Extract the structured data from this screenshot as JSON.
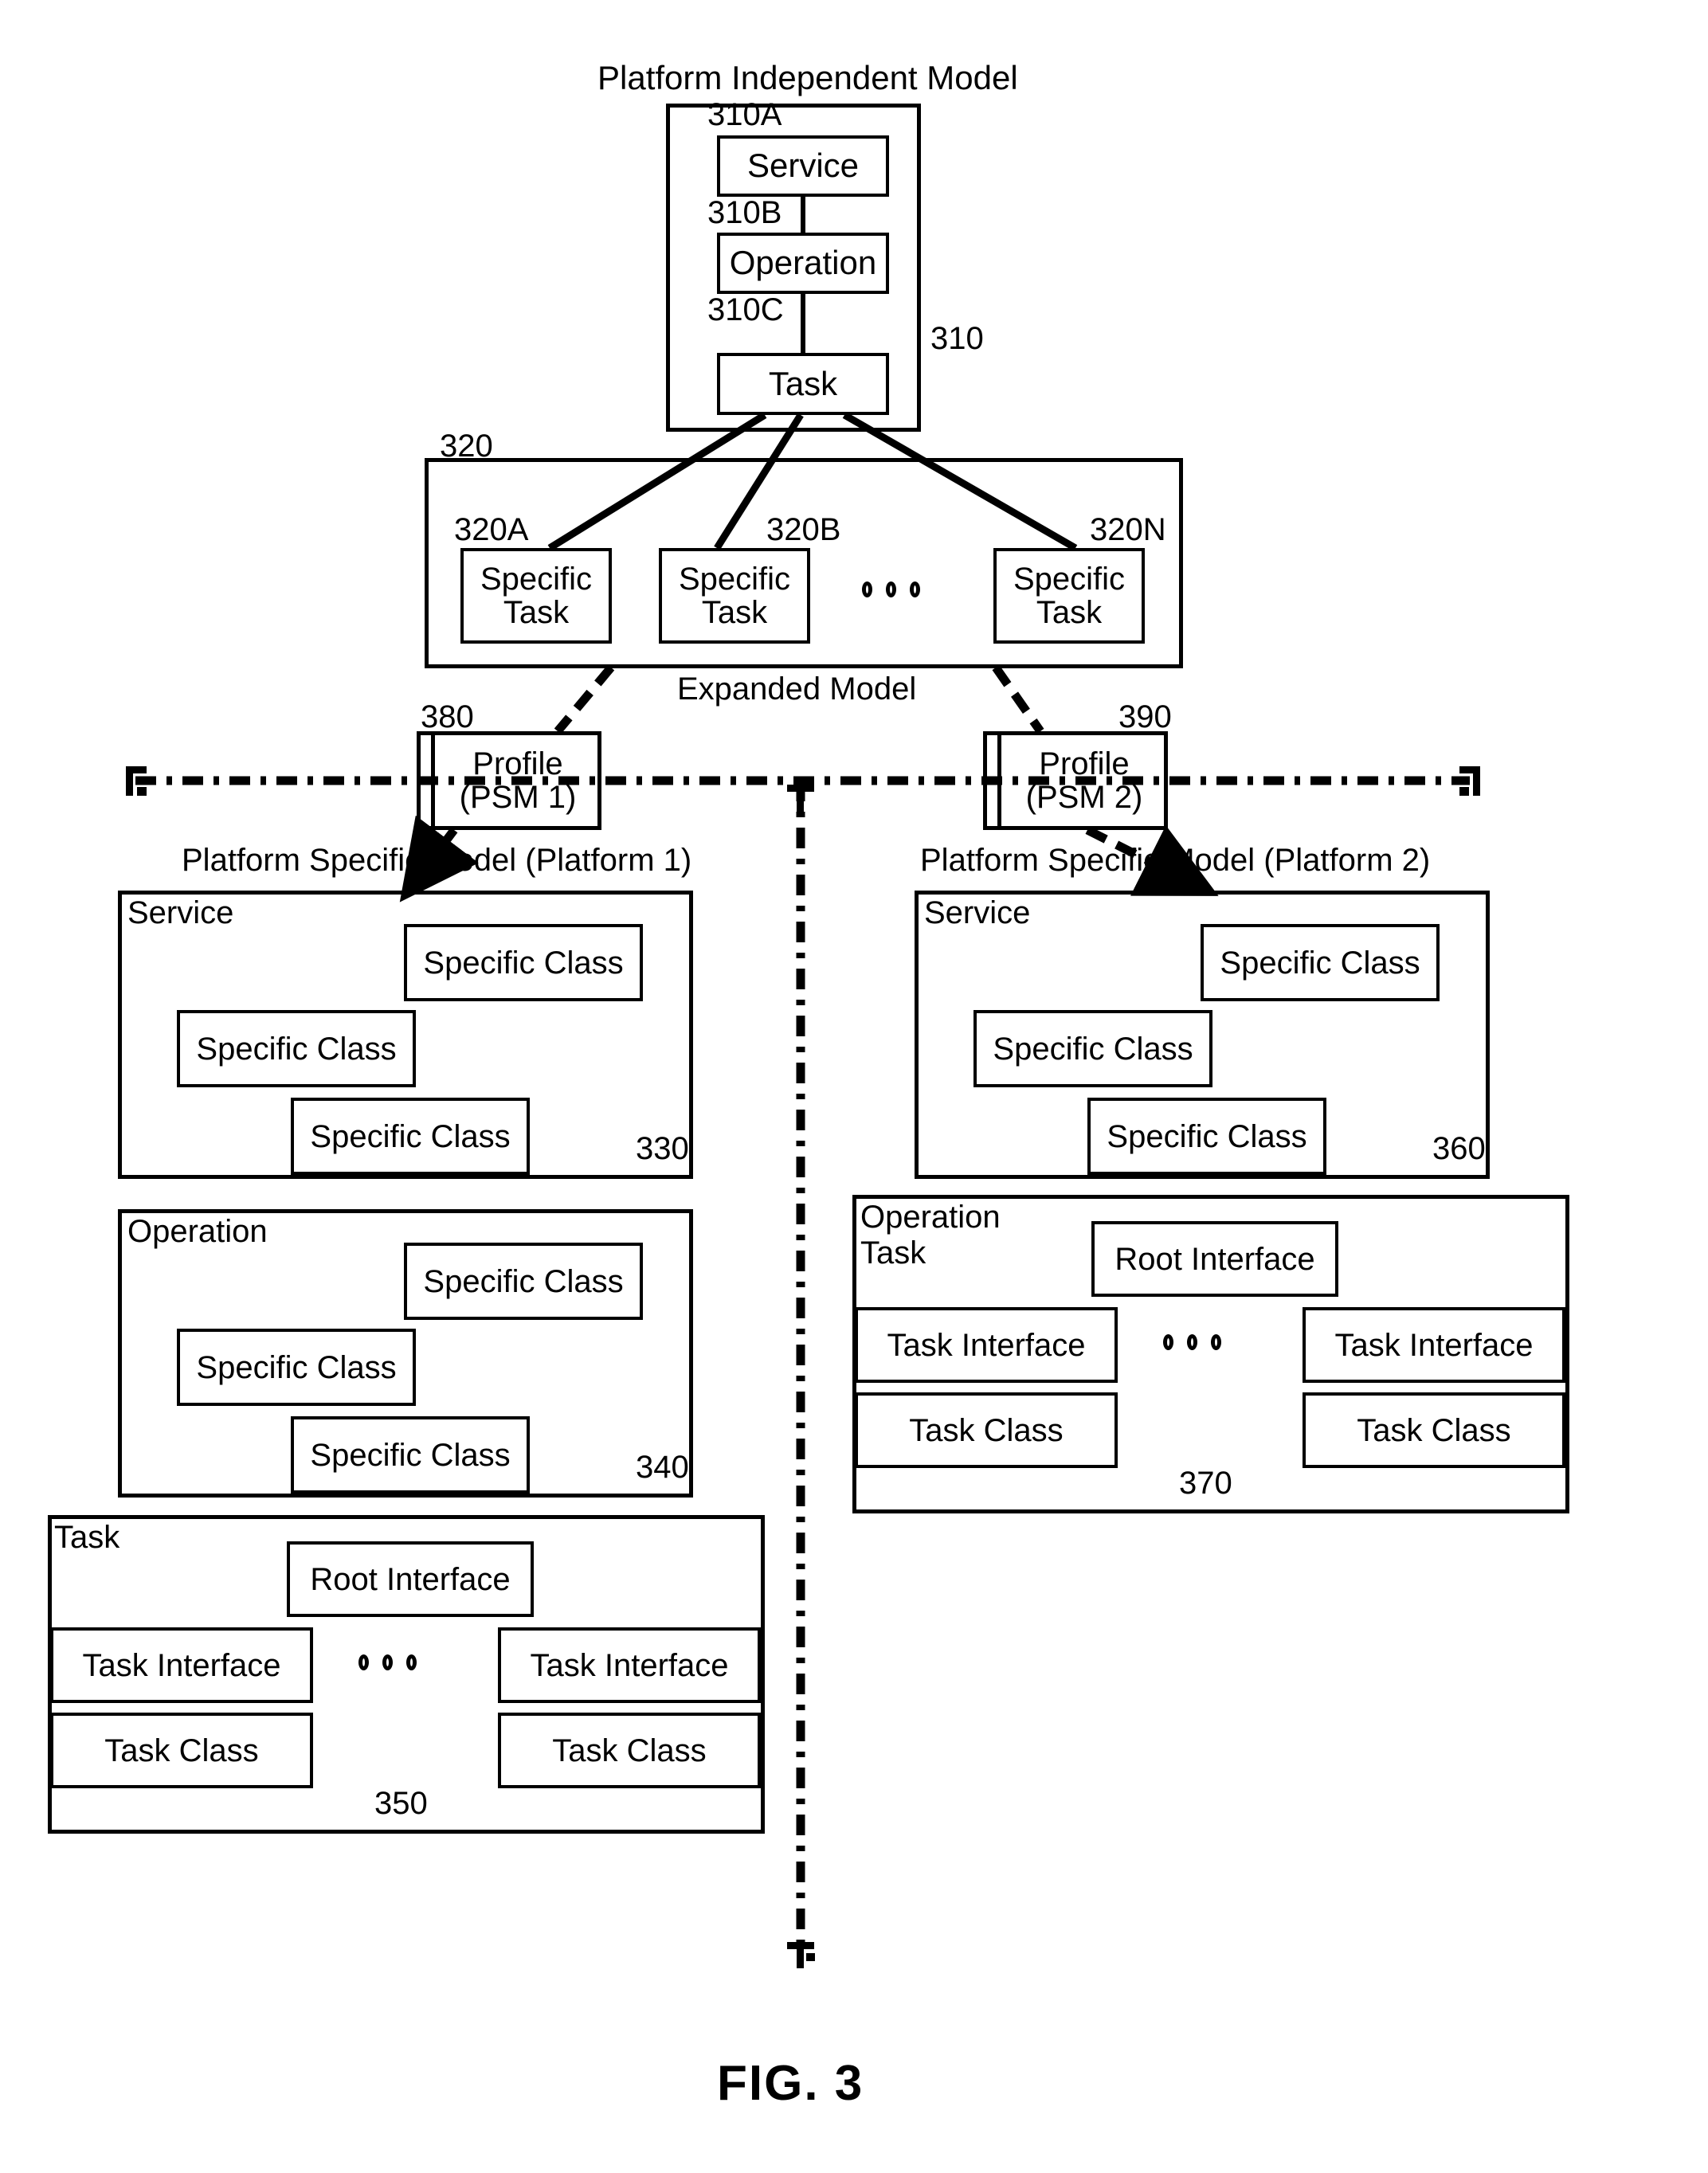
{
  "figure": {
    "caption": "FIG. 3"
  },
  "pim": {
    "title": "Platform Independent Model",
    "ref": "310",
    "nodes": [
      {
        "ref": "310A",
        "label": "Service"
      },
      {
        "ref": "310B",
        "label": "Operation"
      },
      {
        "ref": "310C",
        "label": "Task"
      }
    ]
  },
  "expanded": {
    "ref": "320",
    "caption": "Expanded Model",
    "tasks": [
      {
        "ref": "320A",
        "line1": "Specific",
        "line2": "Task"
      },
      {
        "ref": "320B",
        "line1": "Specific",
        "line2": "Task"
      },
      {
        "ref": "320N",
        "line1": "Specific",
        "line2": "Task"
      }
    ],
    "ellipsis": "o o o"
  },
  "profiles": [
    {
      "ref": "380",
      "line1": "Profile",
      "line2": "(PSM 1)"
    },
    {
      "ref": "390",
      "line1": "Profile",
      "line2": "(PSM 2)"
    }
  ],
  "psm1": {
    "title": "Platform Specific Model (Platform 1)",
    "groups": [
      {
        "ref": "330",
        "label": "Service",
        "items": [
          "Specific Class",
          "Specific Class",
          "Specific Class"
        ]
      },
      {
        "ref": "340",
        "label": "Operation",
        "items": [
          "Specific Class",
          "Specific Class",
          "Specific Class"
        ]
      },
      {
        "ref": "350",
        "label": "Task",
        "root": "Root Interface",
        "left_interface": "Task Interface",
        "right_interface": "Task Interface",
        "left_class": "Task Class",
        "right_class": "Task Class",
        "ellipsis": "o o o"
      }
    ]
  },
  "psm2": {
    "title": "Platform Specific Model (Platform 2)",
    "groups": [
      {
        "ref": "360",
        "label": "Service",
        "items": [
          "Specific Class",
          "Specific Class",
          "Specific Class"
        ]
      },
      {
        "ref": "370",
        "label_line1": "Operation",
        "label_line2": "Task",
        "root": "Root Interface",
        "left_interface": "Task Interface",
        "right_interface": "Task Interface",
        "left_class": "Task Class",
        "right_class": "Task Class",
        "ellipsis": "o o o"
      }
    ]
  },
  "colors": {
    "ink": "#000000",
    "paper": "#ffffff"
  }
}
